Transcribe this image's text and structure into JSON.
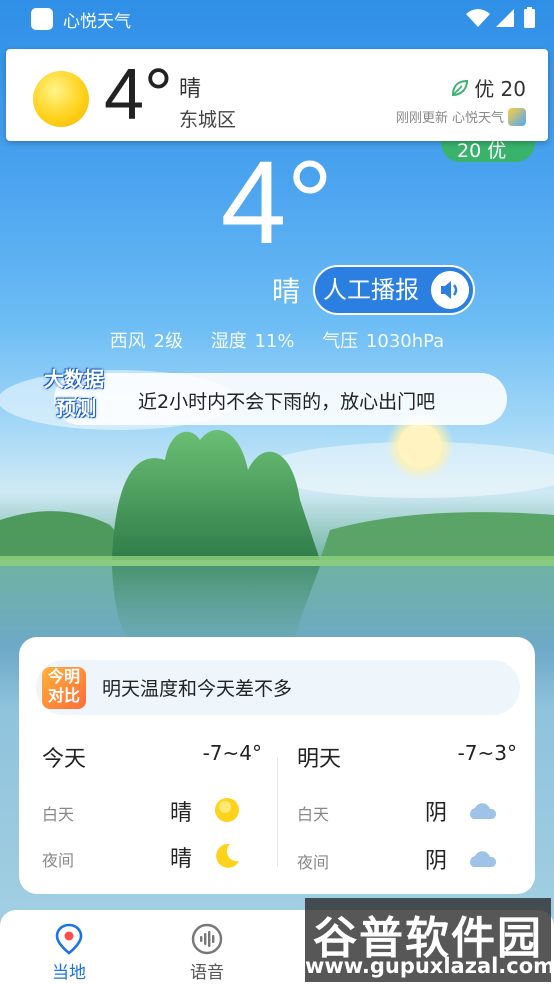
{
  "status_bar": {
    "app_name": "心悦天气"
  },
  "notification": {
    "temperature": "4°",
    "condition": "晴",
    "district": "东城区",
    "aqi": "优 20",
    "updated": "刚刚更新",
    "app_name": "心悦天气"
  },
  "aqi_pill": {
    "text": "20 优",
    "color": "#39b36c"
  },
  "current": {
    "temperature": "4°",
    "condition": "晴",
    "broadcast_label": "人工播报",
    "wind": "西风 2级",
    "humidity": "湿度 11%",
    "pressure": "气压 1030hPa"
  },
  "forecast_banner": {
    "badge_line1": "大数据",
    "badge_line2": "预测",
    "text": "近2小时内不会下雨的，放心出门吧"
  },
  "daily": {
    "compare_badge_line1": "今明",
    "compare_badge_line2": "对比",
    "compare_text": "明天温度和今天差不多",
    "today": {
      "name": "今天",
      "range": "-7~4°",
      "day_label": "白天",
      "day_cond": "晴",
      "day_icon": "sun-icon",
      "night_label": "夜间",
      "night_cond": "晴",
      "night_icon": "moon-icon"
    },
    "tomorrow": {
      "name": "明天",
      "range": "-7~3°",
      "day_label": "白天",
      "day_cond": "阴",
      "day_icon": "cloud-icon",
      "night_label": "夜间",
      "night_cond": "阴",
      "night_icon": "cloud-icon"
    }
  },
  "tabs": [
    {
      "label": "当地",
      "icon": "location-pin-icon",
      "active": true,
      "color": "#1a73e8"
    },
    {
      "label": "语音",
      "icon": "voice-icon",
      "active": false,
      "color": "#555555"
    }
  ],
  "watermark": {
    "title": "谷普软件园",
    "url": "www.gupuxlazal.com"
  }
}
